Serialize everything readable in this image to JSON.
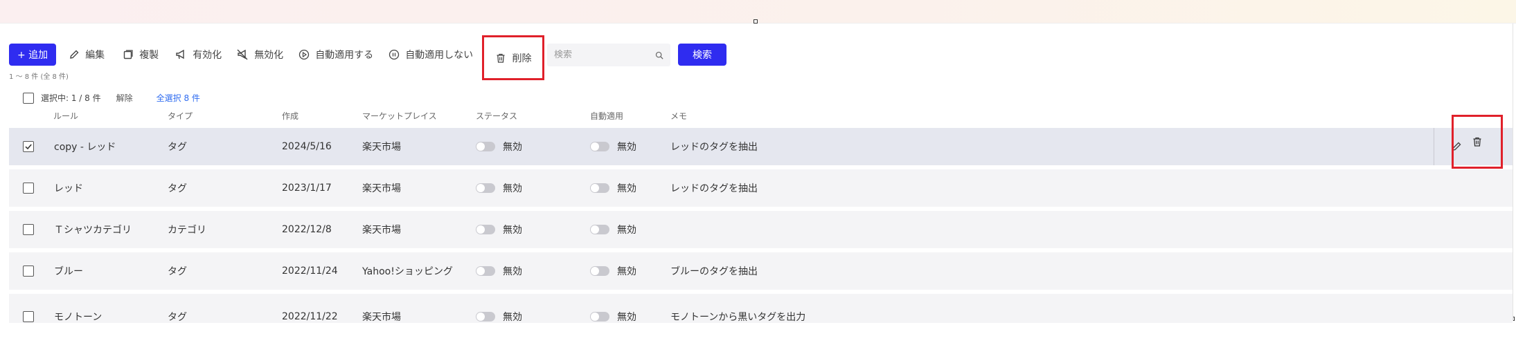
{
  "toolbar": {
    "add_label": "+ 追加",
    "edit_label": "編集",
    "copy_label": "複製",
    "enable_label": "有効化",
    "disable_label": "無効化",
    "auto_apply_label": "自動適用する",
    "no_auto_apply_label": "自動適用しない",
    "delete_label": "削除"
  },
  "search": {
    "placeholder": "検索",
    "button_label": "検索"
  },
  "count_text": "1 〜 8 件 (全 8 件)",
  "selection": {
    "status": "選択中: 1 / 8 件",
    "clear": "解除",
    "select_all": "全選択 8 件"
  },
  "headers": {
    "rule": "ルール",
    "type": "タイプ",
    "created": "作成",
    "marketplace": "マーケットプレイス",
    "status": "ステータス",
    "auto_apply": "自動適用",
    "memo": "メモ"
  },
  "rows": [
    {
      "rule": "copy - レッド",
      "type": "タグ",
      "created": "2024/5/16",
      "marketplace": "楽天市場",
      "status": "無効",
      "auto_apply": "無効",
      "memo": "レッドのタグを抽出",
      "checked": true
    },
    {
      "rule": "レッド",
      "type": "タグ",
      "created": "2023/1/17",
      "marketplace": "楽天市場",
      "status": "無効",
      "auto_apply": "無効",
      "memo": "レッドのタグを抽出",
      "checked": false
    },
    {
      "rule": "Ｔシャツカテゴリ",
      "type": "カテゴリ",
      "created": "2022/12/8",
      "marketplace": "楽天市場",
      "status": "無効",
      "auto_apply": "無効",
      "memo": "",
      "checked": false
    },
    {
      "rule": "ブルー",
      "type": "タグ",
      "created": "2022/11/24",
      "marketplace": "Yahoo!ショッピング",
      "status": "無効",
      "auto_apply": "無効",
      "memo": "ブルーのタグを抽出",
      "checked": false
    },
    {
      "rule": "モノトーン",
      "type": "タグ",
      "created": "2022/11/22",
      "marketplace": "楽天市場",
      "status": "無効",
      "auto_apply": "無効",
      "memo": "モノトーンから黒いタグを出力",
      "checked": false
    }
  ],
  "colors": {
    "primary": "#2f2cf0",
    "highlight": "#e0202a",
    "link": "#2f6cf0"
  }
}
